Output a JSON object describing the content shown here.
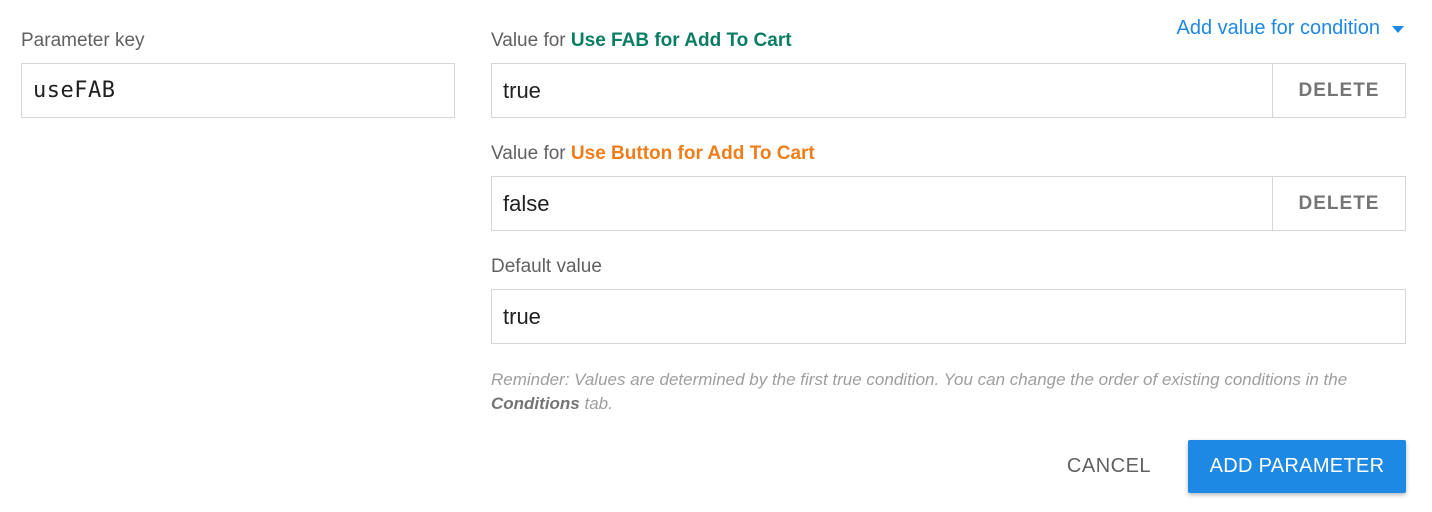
{
  "colors": {
    "accent": "#1e88e5",
    "condition_fab": "#0b7d63",
    "condition_button": "#ef7d1a"
  },
  "parameter": {
    "key_label": "Parameter key",
    "key_value": "useFAB"
  },
  "add_condition": {
    "label": "Add value for condition",
    "icon": "caret-down-icon"
  },
  "conditional_values": [
    {
      "prefix": "Value for ",
      "condition_name": "Use FAB for Add To Cart",
      "value": "true",
      "delete_label": "DELETE"
    },
    {
      "prefix": "Value for ",
      "condition_name": "Use Button for Add To Cart",
      "value": "false",
      "delete_label": "DELETE"
    }
  ],
  "default_value": {
    "label": "Default value",
    "value": "true"
  },
  "reminder": {
    "text_before": "Reminder: Values are determined by the first true condition. You can change the order of existing conditions in the ",
    "bold": "Conditions",
    "text_after": " tab."
  },
  "actions": {
    "cancel_label": "CANCEL",
    "add_parameter_label": "ADD PARAMETER"
  }
}
